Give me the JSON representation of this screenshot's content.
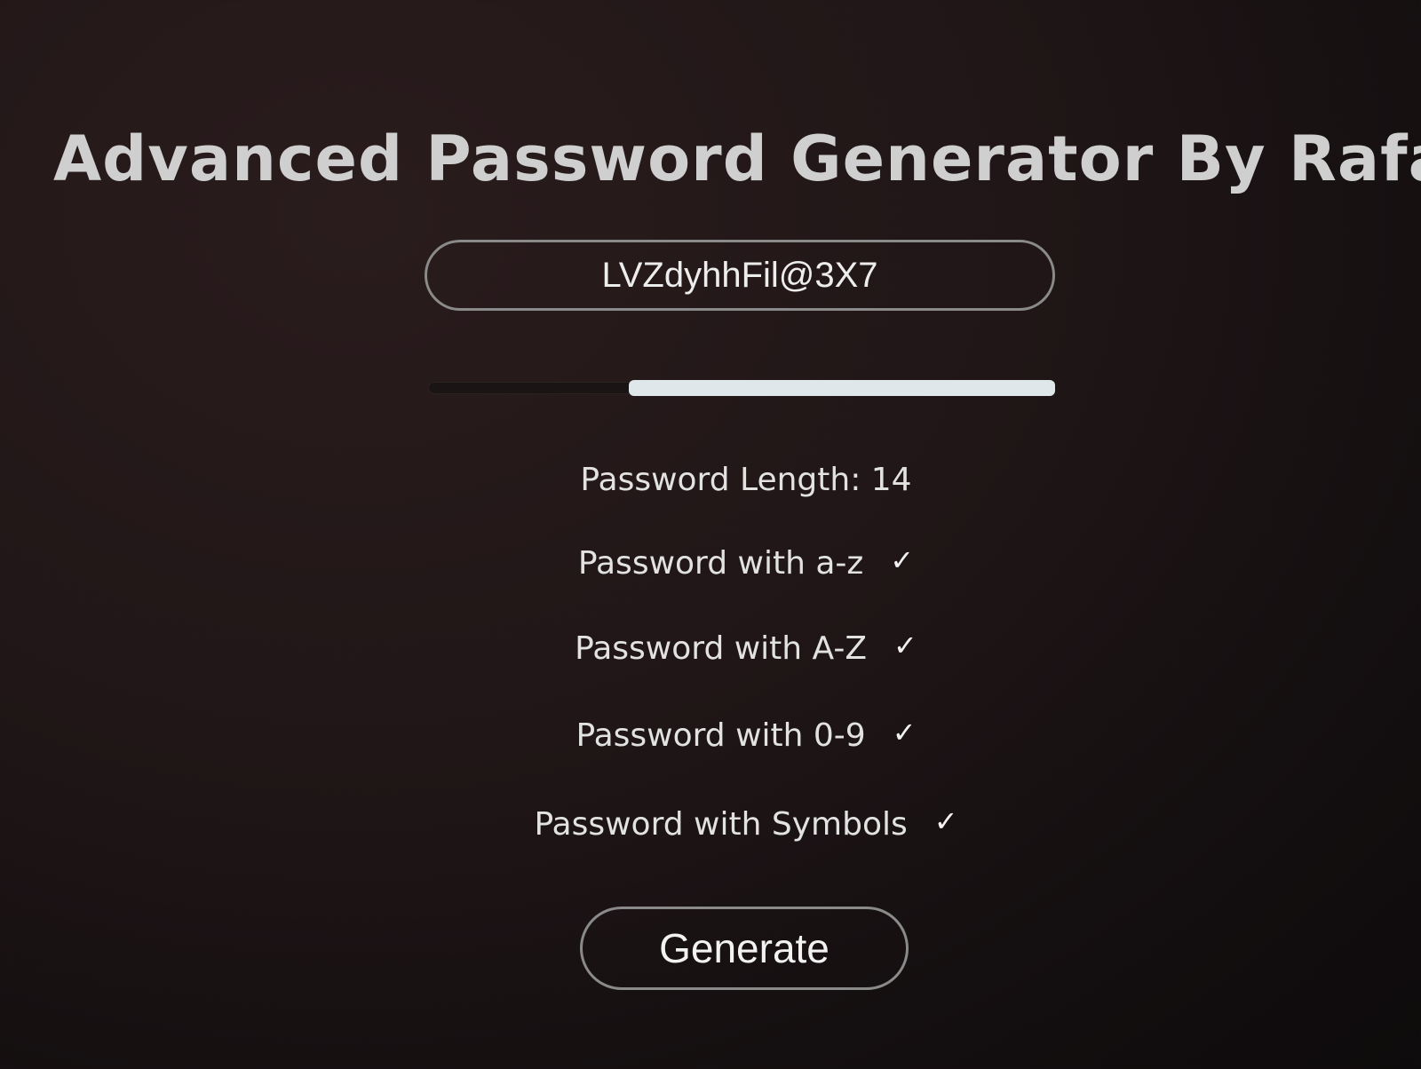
{
  "app": {
    "title": "Advanced Password Generator By Rafay"
  },
  "password": {
    "value": "LVZdyhhFil@3X7"
  },
  "strength": {
    "fraction": 0.68
  },
  "length": {
    "label": "Password Length: 14"
  },
  "options": [
    {
      "label": "Password with a-z",
      "checked": true,
      "mark": "✓"
    },
    {
      "label": "Password with A-Z",
      "checked": true,
      "mark": "✓"
    },
    {
      "label": "Password with 0-9",
      "checked": true,
      "mark": "✓"
    },
    {
      "label": "Password with Symbols",
      "checked": true,
      "mark": "✓"
    }
  ],
  "actions": {
    "generate_label": "Generate"
  },
  "icons": {
    "option_check": "checkmark-icon"
  }
}
